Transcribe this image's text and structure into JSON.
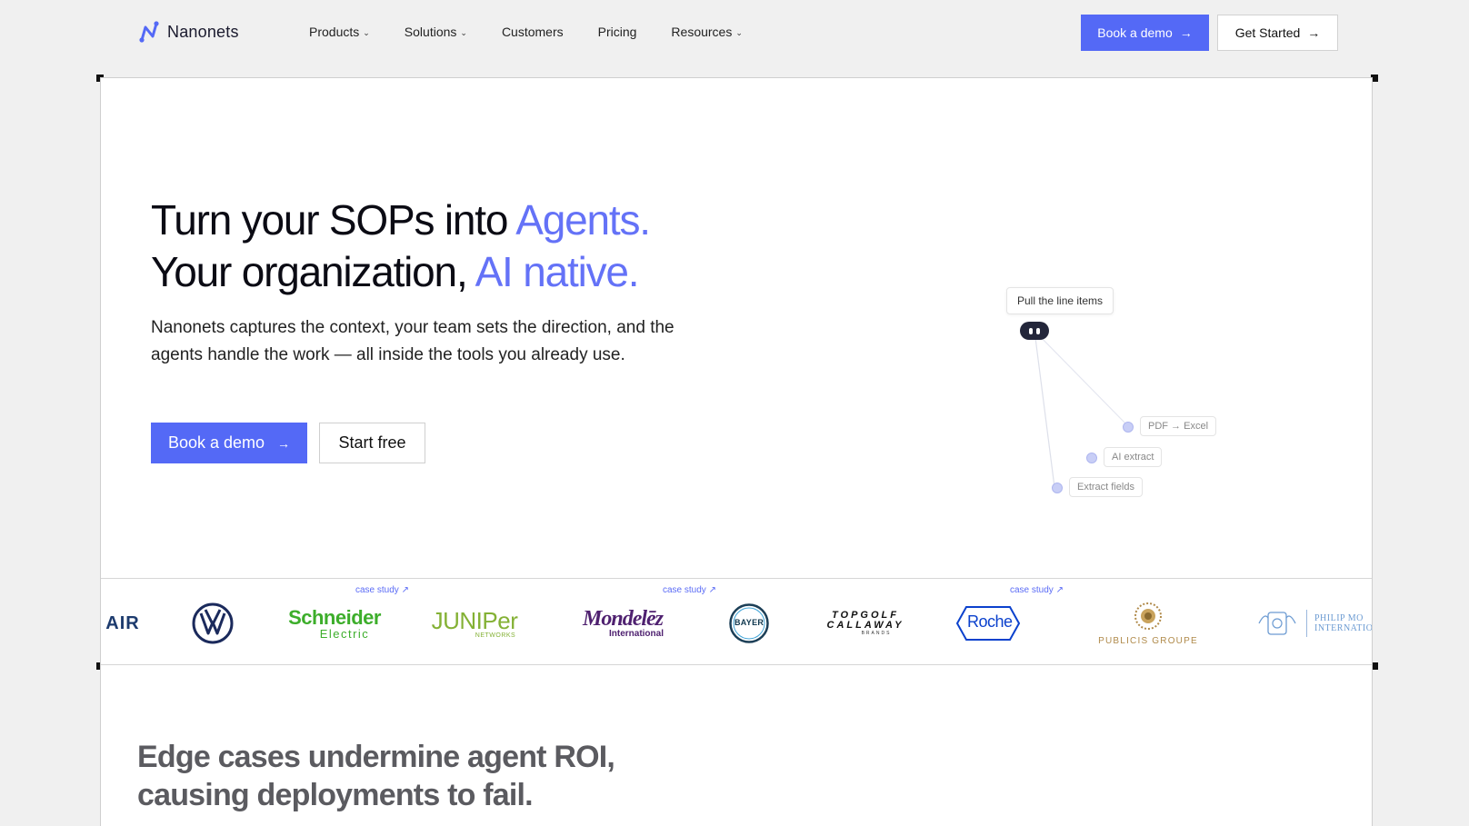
{
  "nav": {
    "brand": "Nanonets",
    "links": [
      {
        "label": "Products",
        "dropdown": true
      },
      {
        "label": "Solutions",
        "dropdown": true
      },
      {
        "label": "Customers",
        "dropdown": false
      },
      {
        "label": "Pricing",
        "dropdown": false
      },
      {
        "label": "Resources",
        "dropdown": true
      }
    ],
    "book_demo": "Book a demo",
    "get_started": "Get Started"
  },
  "hero": {
    "line1_plain": "Turn your SOPs into ",
    "line1_accent": "Agents.",
    "line2_plain": "Your organization, ",
    "line2_accent": "AI native.",
    "subtitle": "Nanonets captures the context, your team sets the direction, and the agents handle the work — all inside the tools you already use.",
    "cta_primary": "Book a demo",
    "cta_secondary": "Start free"
  },
  "agent_graph": {
    "prompt": "Pull the line items",
    "steps": [
      "PDF → Excel",
      "AI extract",
      "Extract fields"
    ]
  },
  "logos": {
    "case_label": "case study ↗",
    "brands": [
      "AIR",
      "Volkswagen",
      "Schneider Electric",
      "Juniper Networks",
      "Mondelēz International",
      "Bayer",
      "Topgolf Callaway Brands",
      "Roche",
      "Publicis Groupe",
      "Philip Morris International"
    ],
    "schneider_line1": "Schneider",
    "schneider_line2": "Electric",
    "juniper_line1": "JUNIPer",
    "juniper_line2": "NETWORKS",
    "mondelez_line1": "Mondelēz",
    "mondelez_line2": "International",
    "bayer_text": "BAYER",
    "topgolf_line1": "TOPGOLF",
    "topgolf_line2": "CALLAWAY",
    "topgolf_line3": "BRANDS",
    "roche_text": "Roche",
    "publicis_text": "PUBLICIS GROUPE",
    "pmi_line1": "PHILIP MO",
    "pmi_line2": "INTERNATIO"
  },
  "section2": {
    "line1": "Edge cases undermine agent ROI,",
    "line2": "causing deployments to fail."
  },
  "colors": {
    "accent": "#5469f6",
    "accent_text": "#6472f7",
    "case_link": "#5b6cf6"
  }
}
